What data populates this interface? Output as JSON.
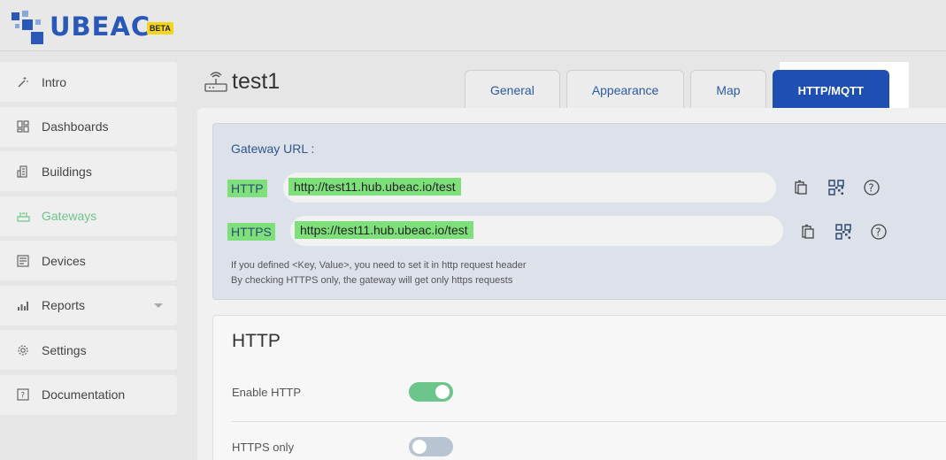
{
  "app": {
    "brand": "UBEAC",
    "badge": "BETA"
  },
  "sidebar": {
    "items": [
      {
        "label": "Intro",
        "icon": "wand-icon"
      },
      {
        "label": "Dashboards",
        "icon": "dashboard-icon"
      },
      {
        "label": "Buildings",
        "icon": "building-icon"
      },
      {
        "label": "Gateways",
        "icon": "gateway-icon",
        "active": true
      },
      {
        "label": "Devices",
        "icon": "device-icon"
      },
      {
        "label": "Reports",
        "icon": "bar-chart-icon",
        "has_submenu": true
      },
      {
        "label": "Settings",
        "icon": "gear-icon"
      },
      {
        "label": "Documentation",
        "icon": "question-icon"
      }
    ],
    "active_color": "#6cc58a"
  },
  "page": {
    "title": "test1"
  },
  "tabs": [
    {
      "label": "General"
    },
    {
      "label": "Appearance"
    },
    {
      "label": "Map"
    },
    {
      "label": "HTTP/MQTT",
      "active": true
    }
  ],
  "gateway": {
    "label": "Gateway URL :",
    "http_label": "HTTP",
    "http_url": "http://test11.hub.ubeac.io/test",
    "https_label": "HTTPS",
    "https_url": "https://test11.hub.ubeac.io/test",
    "note1": "If you defined <Key, Value>, you need to set it in http request header",
    "note2": "By checking HTTPS only, the gateway will get only https requests"
  },
  "http_section": {
    "title": "HTTP",
    "enable_label": "Enable HTTP",
    "enable_on": true,
    "https_only_label": "HTTPS only",
    "https_only_on": false
  },
  "colors": {
    "accent": "#1f4fb3",
    "highlight": "#7ee07b",
    "toggle_on": "#6cc58a"
  }
}
